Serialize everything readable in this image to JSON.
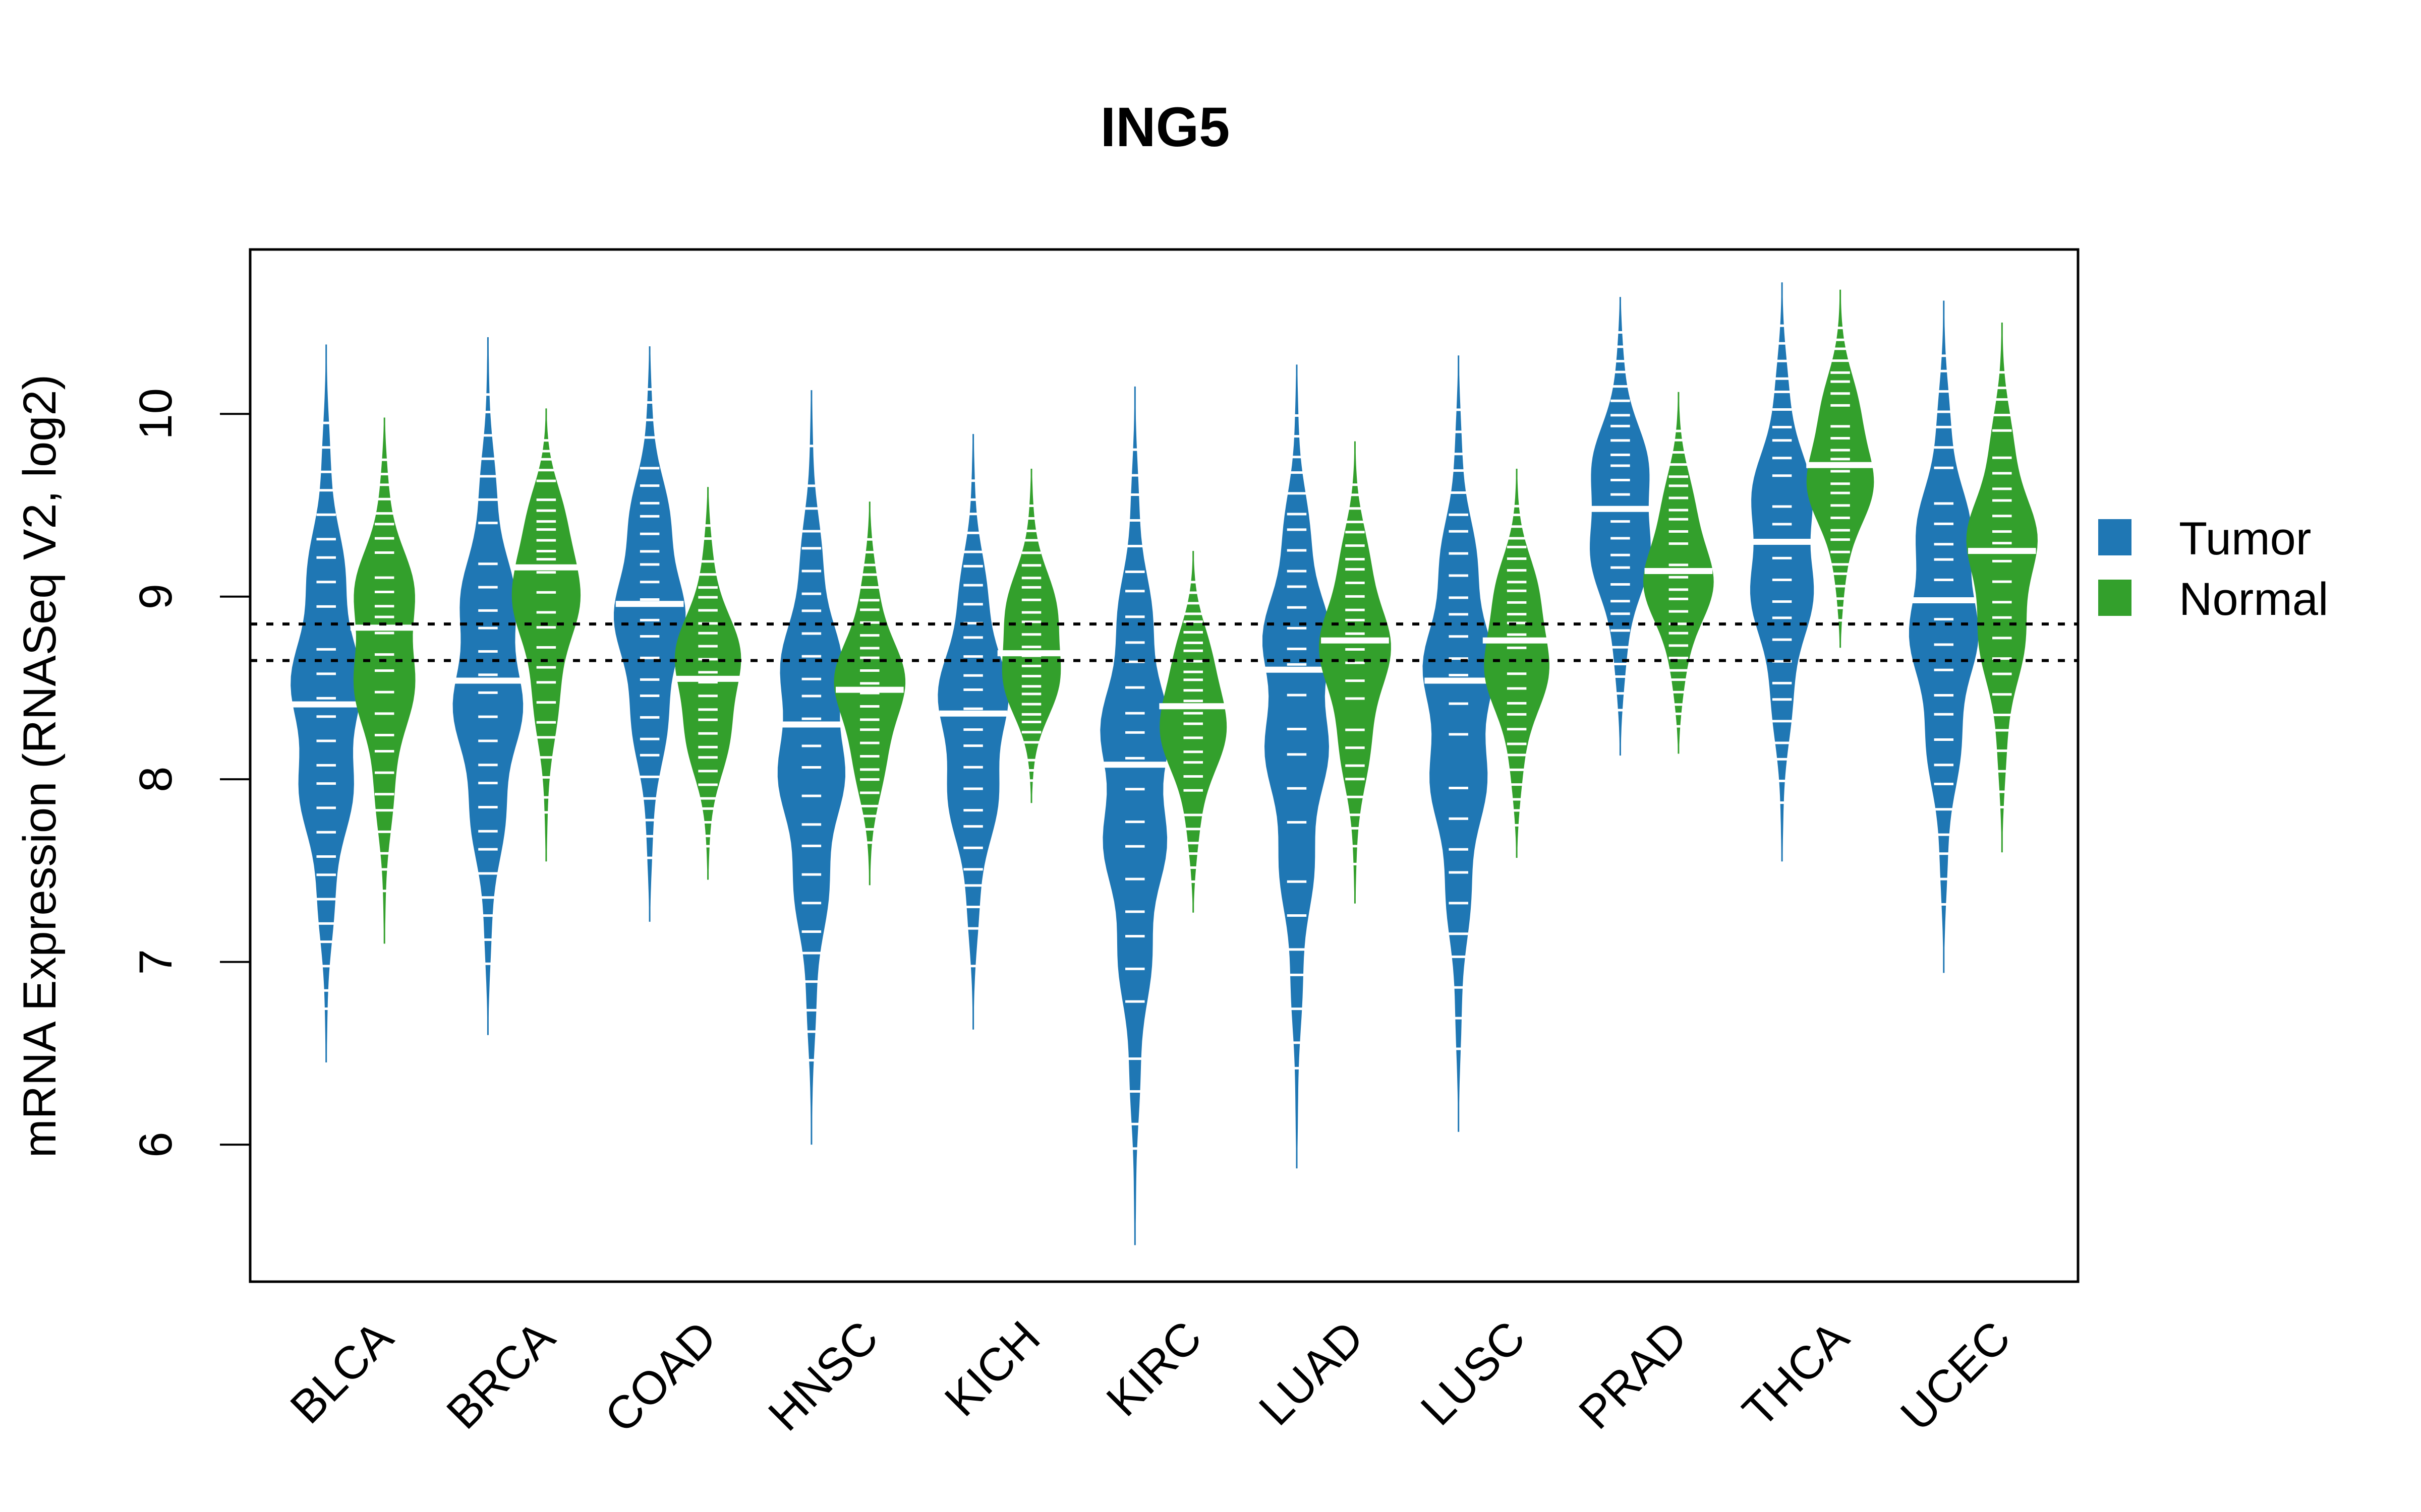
{
  "chart_data": {
    "type": "beanplot",
    "title": "ING5",
    "xlabel": "",
    "ylabel": "mRNA Expression (RNASeq V2, log2)",
    "ylim": [
      5.25,
      10.9
    ],
    "yticks": [
      6,
      7,
      8,
      9,
      10
    ],
    "grid": false,
    "reference_lines": [
      8.85,
      8.65
    ],
    "legend": {
      "position": "right",
      "entries": [
        {
          "name": "Tumor",
          "color": "#1f77b4"
        },
        {
          "name": "Normal",
          "color": "#33a02c"
        }
      ]
    },
    "categories": [
      "BLCA",
      "BRCA",
      "COAD",
      "HNSC",
      "KICH",
      "KIRC",
      "LUAD",
      "LUSC",
      "PRAD",
      "THCA",
      "UCEC"
    ],
    "series": [
      {
        "name": "Tumor",
        "color": "#1f77b4",
        "median": [
          8.41,
          8.54,
          8.96,
          8.3,
          8.36,
          8.08,
          8.6,
          8.54,
          9.48,
          9.3,
          8.98
        ],
        "min": [
          6.45,
          6.6,
          7.22,
          6.0,
          6.63,
          5.45,
          5.87,
          6.07,
          8.13,
          7.55,
          6.94
        ],
        "max": [
          10.38,
          10.42,
          10.37,
          10.13,
          9.89,
          10.15,
          10.27,
          10.32,
          10.64,
          10.72,
          10.62
        ]
      },
      {
        "name": "Normal",
        "color": "#33a02c",
        "median": [
          8.83,
          9.16,
          8.55,
          8.49,
          8.69,
          8.4,
          8.76,
          8.76,
          9.14,
          9.72,
          9.25
        ],
        "min": [
          7.1,
          7.55,
          7.45,
          7.42,
          7.87,
          7.27,
          7.32,
          7.57,
          8.14,
          8.72,
          7.6
        ],
        "max": [
          9.98,
          10.03,
          9.6,
          9.52,
          9.7,
          9.25,
          9.85,
          9.7,
          10.12,
          10.68,
          10.5
        ]
      }
    ]
  }
}
